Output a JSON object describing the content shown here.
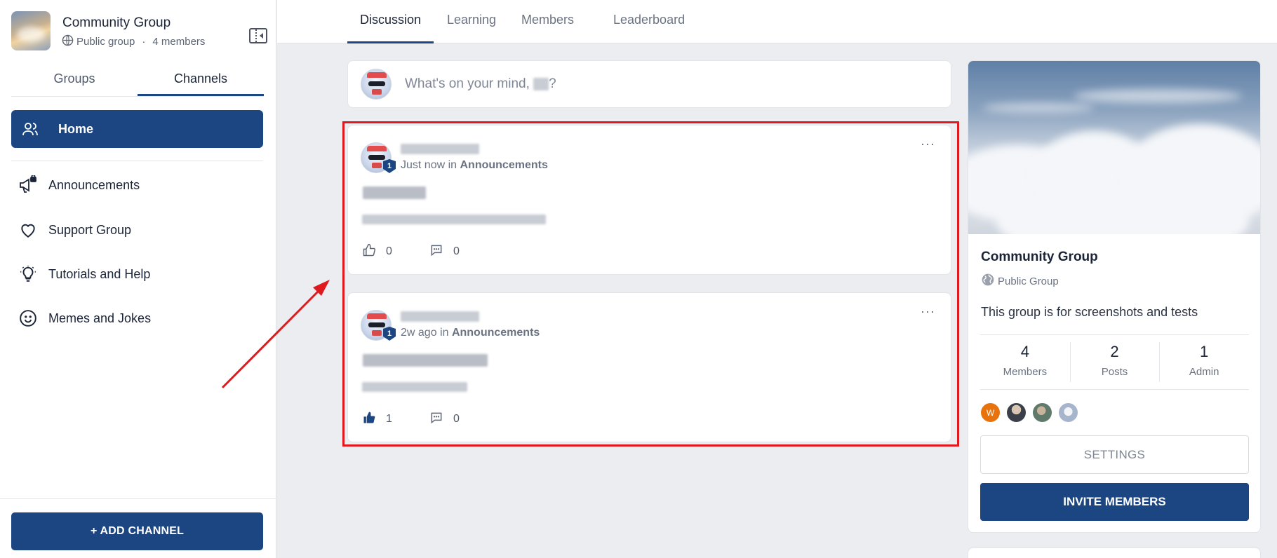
{
  "sidebar": {
    "group_title": "Community Group",
    "group_privacy": "Public group",
    "group_members": "4 members",
    "tabs": [
      {
        "label": "Groups",
        "active": false
      },
      {
        "label": "Channels",
        "active": true
      }
    ],
    "home": {
      "label": "Home",
      "icon": "users-icon"
    },
    "channels": [
      {
        "label": "Announcements",
        "icon": "megaphone-lock-icon"
      },
      {
        "label": "Support Group",
        "icon": "heart-icon"
      },
      {
        "label": "Tutorials and Help",
        "icon": "lightbulb-icon"
      },
      {
        "label": "Memes and Jokes",
        "icon": "smiley-icon"
      }
    ],
    "add_channel_label": "+ ADD CHANNEL"
  },
  "top_tabs": [
    {
      "label": "Discussion",
      "active": true
    },
    {
      "label": "Learning",
      "active": false
    },
    {
      "label": "Members",
      "active": false
    },
    {
      "label": "Leaderboard",
      "active": false
    }
  ],
  "composer": {
    "prompt_prefix": "What's on your mind,",
    "prompt_suffix": "?"
  },
  "posts": [
    {
      "time": "Just now",
      "in_word": "in",
      "channel": "Announcements",
      "badge": "1",
      "likes": "0",
      "comments": "0",
      "liked": false
    },
    {
      "time": "2w ago",
      "in_word": "in",
      "channel": "Announcements",
      "badge": "1",
      "likes": "1",
      "comments": "0",
      "liked": true
    }
  ],
  "about": {
    "name": "Community Group",
    "type": "Public Group",
    "description": "This group is for screenshots and tests",
    "stats": [
      {
        "value": "4",
        "label": "Members"
      },
      {
        "value": "2",
        "label": "Posts"
      },
      {
        "value": "1",
        "label": "Admin"
      }
    ],
    "avatar_initial": "W",
    "settings_label": "SETTINGS",
    "invite_label": "INVITE MEMBERS"
  },
  "colors": {
    "primary": "#1c4682",
    "highlight": "#e0191f",
    "background": "#ebedf1"
  }
}
